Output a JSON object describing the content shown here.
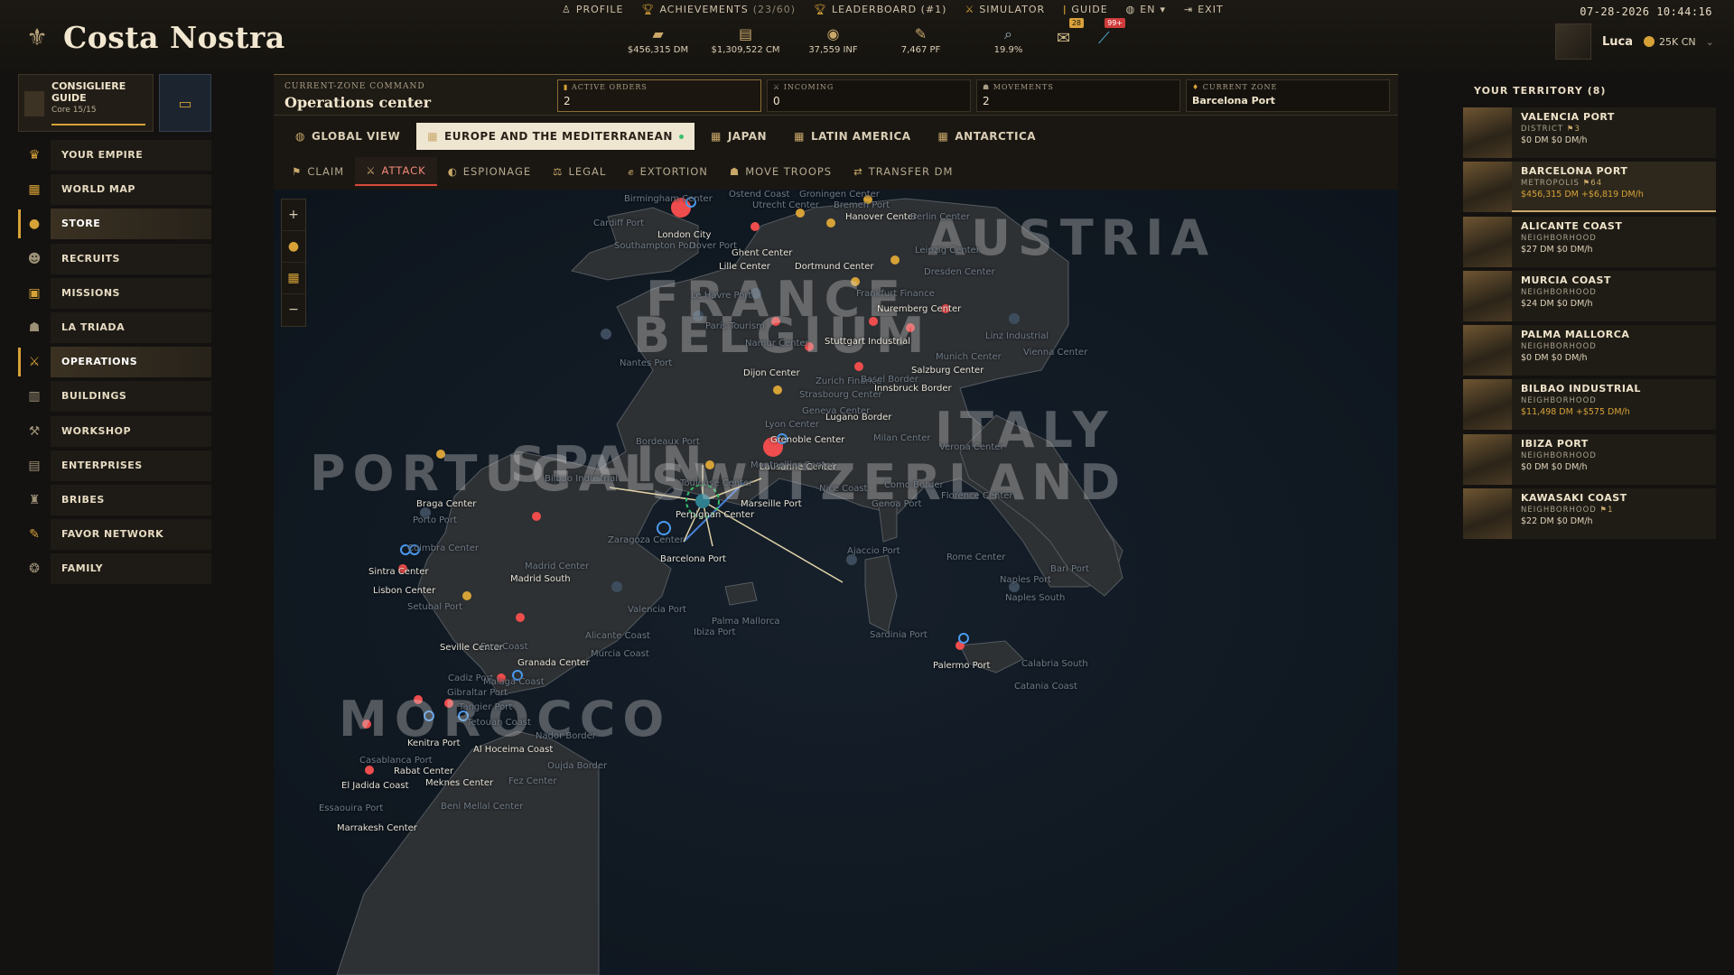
{
  "app": {
    "title": "Costa Nostra"
  },
  "top_nav": [
    {
      "label": "PROFILE",
      "icon": "person-icon"
    },
    {
      "label": "ACHIEVEMENTS",
      "sub": "(23/60)",
      "icon": "trophy-icon"
    },
    {
      "label": "LEADERBOARD (#1)",
      "icon": "trophy-icon"
    },
    {
      "label": "SIMULATOR",
      "icon": "swords-icon"
    },
    {
      "label": "GUIDE",
      "icon": "lamp-icon"
    },
    {
      "label": "EN",
      "icon": "globe-icon"
    },
    {
      "label": "EXIT",
      "icon": "exit-icon"
    }
  ],
  "datetime": "07-28-2026 10:44:16",
  "resources": [
    {
      "value": "$456,315 DM",
      "icon": "cash-icon"
    },
    {
      "value": "$1,309,522 CM",
      "icon": "cash-stack-icon"
    },
    {
      "value": "37,559 INF",
      "icon": "influence-icon"
    },
    {
      "value": "7,467 PF",
      "icon": "feather-icon"
    },
    {
      "value": "19.9%",
      "icon": "magnifier-icon"
    }
  ],
  "notifications": [
    {
      "badge": "28",
      "icon": "mail-icon"
    },
    {
      "badge": "99+",
      "icon": "syringe-icon"
    }
  ],
  "user": {
    "name": "Luca",
    "currency": "25K CN"
  },
  "guide": {
    "title": "CONSIGLIERE GUIDE",
    "progress": "Core 15/15"
  },
  "menu": [
    {
      "label": "YOUR EMPIRE",
      "icon": "crown-icon",
      "active": false
    },
    {
      "label": "WORLD MAP",
      "icon": "map-icon",
      "active": false
    },
    {
      "label": "STORE",
      "icon": "coin-icon",
      "active": true
    },
    {
      "label": "RECRUITS",
      "icon": "recruits-icon",
      "active": false
    },
    {
      "label": "MISSIONS",
      "icon": "missions-icon",
      "active": false
    },
    {
      "label": "LA TRIADA",
      "icon": "triad-icon",
      "active": false
    },
    {
      "label": "OPERATIONS",
      "icon": "swords-icon",
      "active": true
    },
    {
      "label": "BUILDINGS",
      "icon": "building-icon",
      "active": false
    },
    {
      "label": "WORKSHOP",
      "icon": "workshop-icon",
      "active": false
    },
    {
      "label": "ENTERPRISES",
      "icon": "enterprise-icon",
      "active": false
    },
    {
      "label": "BRIBES",
      "icon": "bribe-icon",
      "active": false
    },
    {
      "label": "FAVOR NETWORK",
      "icon": "feather-icon",
      "active": false
    },
    {
      "label": "FAMILY",
      "icon": "family-icon",
      "active": false
    }
  ],
  "command": {
    "kicker": "CURRENT-ZONE COMMAND",
    "title": "Operations center",
    "stats": [
      {
        "label": "ACTIVE ORDERS",
        "value": "2"
      },
      {
        "label": "INCOMING",
        "value": "0"
      },
      {
        "label": "MOVEMENTS",
        "value": "2"
      },
      {
        "label": "CURRENT ZONE",
        "value": "Barcelona Port"
      }
    ]
  },
  "region_tabs": [
    {
      "label": "GLOBAL VIEW",
      "active": false
    },
    {
      "label": "EUROPE AND THE MEDITERRANEAN",
      "active": true
    },
    {
      "label": "JAPAN",
      "active": false
    },
    {
      "label": "LATIN AMERICA",
      "active": false
    },
    {
      "label": "ANTARCTICA",
      "active": false
    }
  ],
  "action_tabs": [
    {
      "label": "CLAIM",
      "active": false
    },
    {
      "label": "ATTACK",
      "active": true
    },
    {
      "label": "ESPIONAGE",
      "active": false
    },
    {
      "label": "LEGAL",
      "active": false
    },
    {
      "label": "EXTORTION",
      "active": false
    },
    {
      "label": "MOVE TROOPS",
      "active": false
    },
    {
      "label": "TRANSFER DM",
      "active": false
    }
  ],
  "map": {
    "countries": [
      "AUSTRIA",
      "FRANCE",
      "BELGIUM",
      "ITALY",
      "PORTUGAL",
      "SPAIN",
      "SWITZERLAND",
      "MOROCCO"
    ],
    "cities": [
      "London City",
      "Ghent Center",
      "Lille Center",
      "Dortmund Center",
      "Hanover Center",
      "Nuremberg Center",
      "Stuttgart Industrial",
      "Salzburg Center",
      "Innsbruck Border",
      "Dijon Center",
      "Lugano Border",
      "Grenoble Center",
      "Lausanne Center",
      "Marseille Port",
      "Perpignan Center",
      "Barcelona Port",
      "Braga Center",
      "Sintra Center",
      "Lisbon Center",
      "Madrid South",
      "Seville Center",
      "Granada Center",
      "Palermo Port",
      "Kenitra Port",
      "Al Hoceima Coast",
      "Rabat Center",
      "El Jadida Coast",
      "Meknes Center",
      "Marrakesh Center"
    ],
    "dim_cities": [
      "Birmingham Center",
      "Cardiff Port",
      "Southampton Port",
      "Dover Port",
      "Ostend Coast",
      "Utrecht Center",
      "Groningen Center",
      "Bremen Port",
      "Berlin Center",
      "Leipzig Center",
      "Dresden Center",
      "Frankfurt Finance",
      "Le Havre Port",
      "Paris Tourism",
      "Nantes Port",
      "Namur Center",
      "Linz Industrial",
      "Vienna Center",
      "Munich Center",
      "Zurich Finance",
      "Strasbourg Center",
      "Basel Border",
      "Geneva Center",
      "Lyon Center",
      "Milan Center",
      "Verona Center",
      "Bordeaux Port",
      "Toulouse Center",
      "Montpellier Center",
      "Nice Coast",
      "Genoa Port",
      "Como Border",
      "Florence Center",
      "Bilbao Industrial",
      "Porto Port",
      "Coimbra Center",
      "Zaragoza Center",
      "Madrid Center",
      "Valencia Port",
      "Setubal Port",
      "Faro Coast",
      "Alicante Coast",
      "Murcia Coast",
      "Palma Mallorca",
      "Ibiza Port",
      "Ajaccio Port",
      "Sardinia Port",
      "Rome Center",
      "Bari Port",
      "Naples Port",
      "Naples South",
      "Calabria South",
      "Catania Coast",
      "Cadiz Port",
      "Malaga Coast",
      "Tangier Port",
      "Tetouan Coast",
      "Nador Border",
      "Oujda Border",
      "Casablanca Port",
      "Fez Center",
      "Beni Mellal Center",
      "Essaouira Port",
      "Gibraltar Port"
    ]
  },
  "territory": {
    "title": "YOUR TERRITORY (8)",
    "items": [
      {
        "name": "VALENCIA PORT",
        "type": "DISTRICT",
        "level": "3",
        "money": "$0 DM",
        "income": "$0 DM/h",
        "active": false
      },
      {
        "name": "BARCELONA PORT",
        "type": "METROPOLIS",
        "level": "64",
        "money": "$456,315 DM",
        "income": "+$6,819 DM/h",
        "active": true
      },
      {
        "name": "ALICANTE COAST",
        "type": "NEIGHBORHOOD",
        "level": "",
        "money": "$27 DM",
        "income": "$0 DM/h",
        "active": false
      },
      {
        "name": "MURCIA COAST",
        "type": "NEIGHBORHOOD",
        "level": "",
        "money": "$24 DM",
        "income": "$0 DM/h",
        "active": false
      },
      {
        "name": "PALMA MALLORCA",
        "type": "NEIGHBORHOOD",
        "level": "",
        "money": "$0 DM",
        "income": "$0 DM/h",
        "active": false
      },
      {
        "name": "BILBAO INDUSTRIAL",
        "type": "NEIGHBORHOOD",
        "level": "",
        "money": "$11,498 DM",
        "income": "+$575 DM/h",
        "active": false
      },
      {
        "name": "IBIZA PORT",
        "type": "NEIGHBORHOOD",
        "level": "",
        "money": "$0 DM",
        "income": "$0 DM/h",
        "active": false
      },
      {
        "name": "KAWASAKI COAST",
        "type": "NEIGHBORHOOD",
        "level": "1",
        "money": "$22 DM",
        "income": "$0 DM/h",
        "active": false
      }
    ]
  }
}
